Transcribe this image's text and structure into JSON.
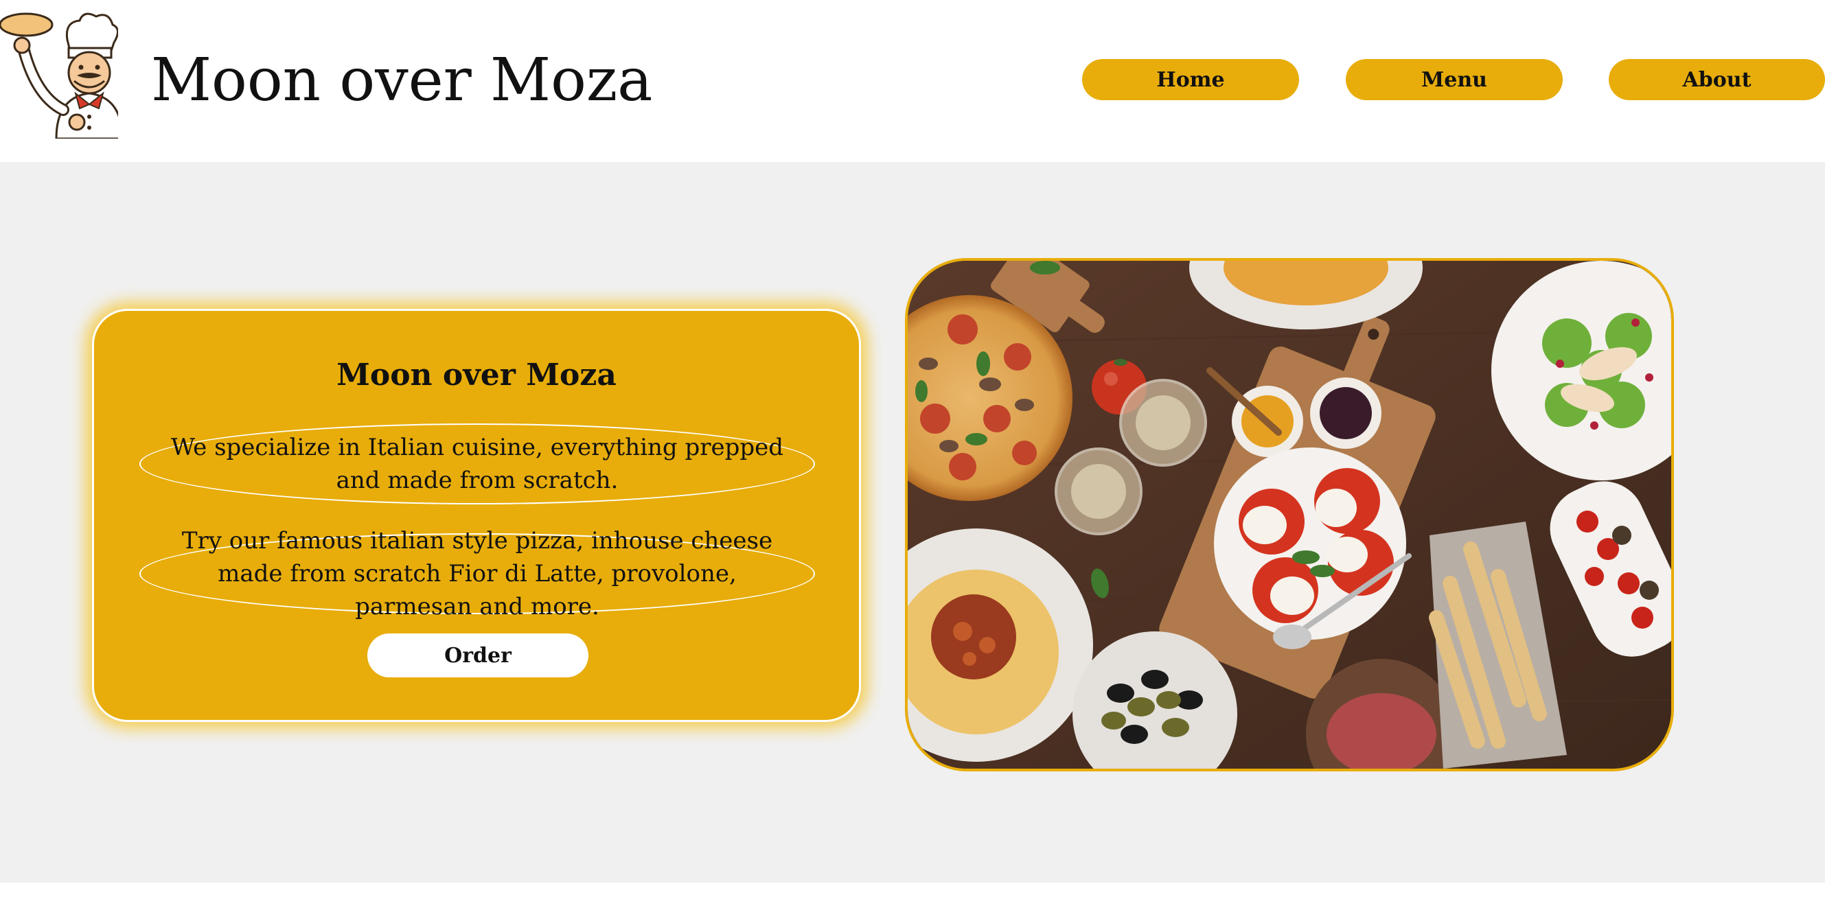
{
  "header": {
    "logo_icon": "chef-tossing-dough-icon",
    "site_title": "Moon over Moza",
    "nav": [
      {
        "label": "Home"
      },
      {
        "label": "Menu"
      },
      {
        "label": "About"
      }
    ]
  },
  "hero": {
    "card": {
      "title": "Moon over Moza",
      "paragraphs": [
        "We specialize in Italian cuisine, everything prepped and made from scratch.",
        "Try our famous italian style pizza, inhouse cheese made from scratch Fior di Latte, provolone, parmesan and more."
      ],
      "order_label": "Order"
    },
    "photo_icon": "italian-food-spread-photo"
  },
  "colors": {
    "accent": "#E8AD0B",
    "band_background": "#F0F0F0",
    "header_background": "#FFFFFF",
    "card_border": "#FFFFFF"
  }
}
